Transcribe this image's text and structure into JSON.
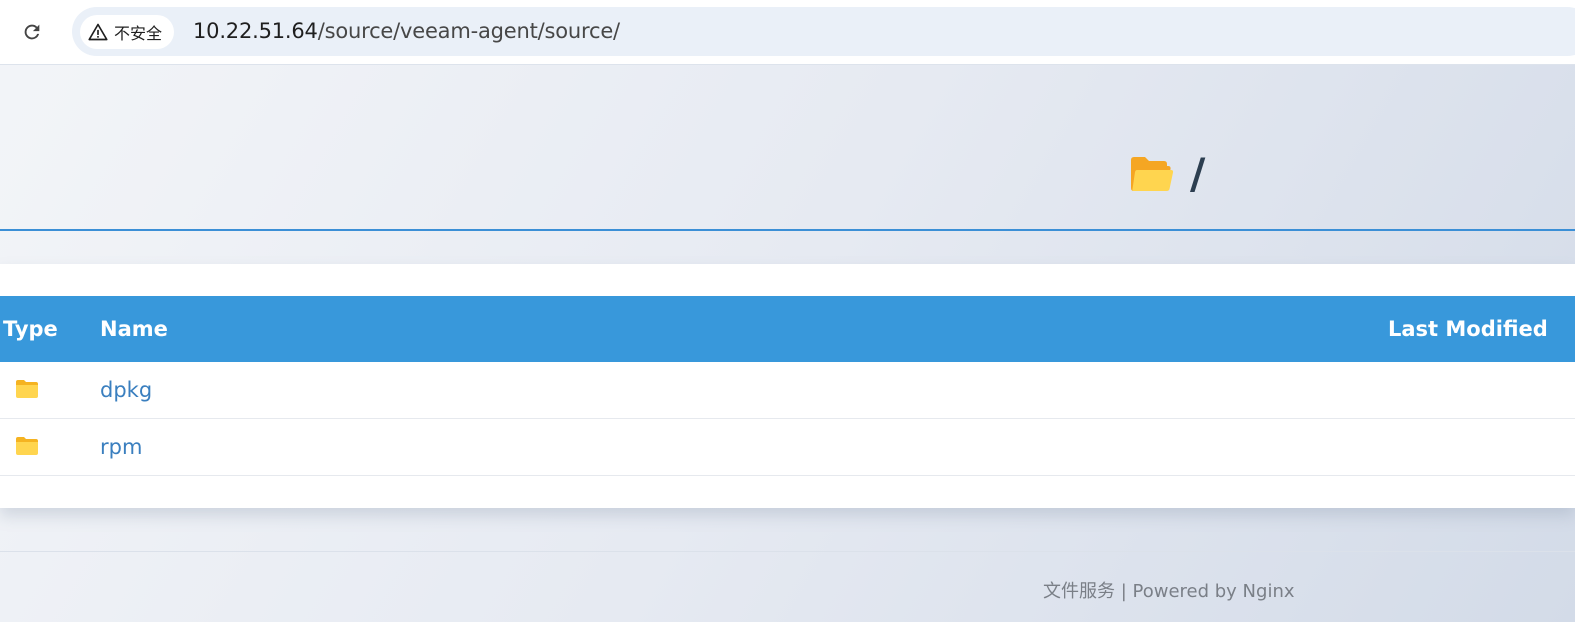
{
  "browser": {
    "security_label": "不安全",
    "url_host": "10.22.51.64",
    "url_path": "/source/veeam-agent/source/",
    "reload_icon": "reload-icon",
    "warning_icon": "warning-triangle-icon"
  },
  "header": {
    "path_title": "/",
    "icon": "folder-open-icon"
  },
  "table": {
    "columns": {
      "type": "Type",
      "name": "Name",
      "last_modified": "Last Modified"
    },
    "rows": [
      {
        "type_icon": "folder-icon",
        "name": "dpkg",
        "last_modified": ""
      },
      {
        "type_icon": "folder-icon",
        "name": "rpm",
        "last_modified": ""
      }
    ]
  },
  "footer": {
    "text": "文件服务 | Powered by Nginx"
  },
  "colors": {
    "header_bg": "#3898db",
    "link": "#3a7fbf",
    "accent_line": "#3b8fd6",
    "folder": "#ffd54f"
  }
}
